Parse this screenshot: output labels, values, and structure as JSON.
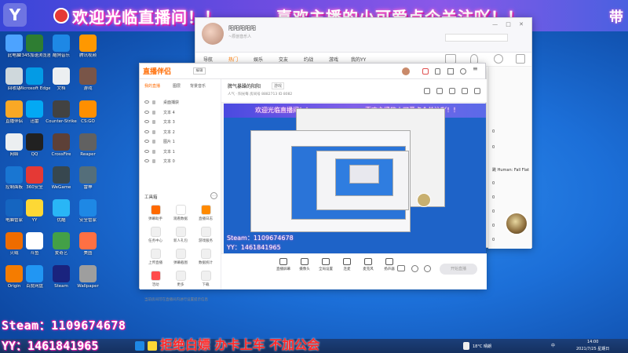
{
  "banner": {
    "logo_char": "Y",
    "welcome_text": "欢迎光临直播间！！",
    "follow_text": "喜欢主播的小可爱点个关注吖！！",
    "right_char": "带"
  },
  "desktop_icons": [
    {
      "label": "此电脑",
      "color": "#4da3ff"
    },
    {
      "label": "2345加速浏览器",
      "color": "#2e7d32"
    },
    {
      "label": "酷狗音乐",
      "color": "#1e88e5"
    },
    {
      "label": "腾讯视频",
      "color": "#ff9800"
    },
    {
      "label": "回收站",
      "color": "#cfd8dc"
    },
    {
      "label": "Microsoft Edge",
      "color": "#039be5"
    },
    {
      "label": "文档",
      "color": "#eceff1"
    },
    {
      "label": "游戏",
      "color": "#795548"
    },
    {
      "label": "直播伴侣",
      "color": "#f9a825"
    },
    {
      "label": "迅雷",
      "color": "#03a9f4"
    },
    {
      "label": "Counter-Strike",
      "color": "#424242"
    },
    {
      "label": "CS:GO",
      "color": "#ff8f00"
    },
    {
      "label": "网络",
      "color": "#eceff1"
    },
    {
      "label": "QQ",
      "color": "#212121"
    },
    {
      "label": "CrossFire",
      "color": "#5d4037"
    },
    {
      "label": "Reaper",
      "color": "#616161"
    },
    {
      "label": "控制面板",
      "color": "#1976d2"
    },
    {
      "label": "360安全",
      "color": "#e53935"
    },
    {
      "label": "WeGame",
      "color": "#37474f"
    },
    {
      "label": "雷神",
      "color": "#546e7a"
    },
    {
      "label": "电脑管家",
      "color": "#1565c0"
    },
    {
      "label": "YY",
      "color": "#fdd835"
    },
    {
      "label": "优酷",
      "color": "#29b6f6"
    },
    {
      "label": "安全管家",
      "color": "#1e88e5"
    },
    {
      "label": "火绒",
      "color": "#ef6c00"
    },
    {
      "label": "斗鱼",
      "color": "#ffffff"
    },
    {
      "label": "爱奇艺",
      "color": "#43a047"
    },
    {
      "label": "美图",
      "color": "#ff7043"
    },
    {
      "label": "Origin",
      "color": "#f57c00"
    },
    {
      "label": "百度网盘",
      "color": "#2196f3"
    },
    {
      "label": "Steam",
      "color": "#1a237e"
    },
    {
      "label": "Wallpaper",
      "color": "#9e9e9e"
    }
  ],
  "yy_window": {
    "user_name": "阳阳阳阳阳",
    "signature": "~原创音乐人",
    "search_placeholder": "",
    "nav": [
      "导航",
      "热门",
      "娱乐",
      "交友",
      "约战",
      "游戏",
      "我的YY"
    ],
    "active_nav_index": 1,
    "list_zeros": [
      "0",
      "0",
      "0",
      "0",
      "0",
      "0",
      "0",
      "0",
      "0",
      "0"
    ],
    "human_fall_flat": "跳 Human: Fall Flat"
  },
  "streamer_window": {
    "logo": "直播伴侣",
    "edit_label": "编辑",
    "tabs": [
      "我的直播",
      "图层",
      "背景音乐"
    ],
    "sources": [
      "桌面捕获",
      "文本 4",
      "文本 3",
      "文本 2",
      "图片 1",
      "文本 1",
      "文本 0"
    ],
    "tools_title": "工具箱",
    "tools": [
      {
        "label": "弹幕助手",
        "color": "#ff6a00"
      },
      {
        "label": "观看数据",
        "color": "#ffffff"
      },
      {
        "label": "直播日志",
        "color": "#ff8a00"
      },
      {
        "label": "任务中心",
        "color": "#f0f0f0"
      },
      {
        "label": "新人礼包",
        "color": "#f0f0f0"
      },
      {
        "label": "游戏服务",
        "color": "#f0f0f0"
      },
      {
        "label": "上传直播",
        "color": "#f0f0f0"
      },
      {
        "label": "弹幕截图",
        "color": "#f0f0f0"
      },
      {
        "label": "数据统计",
        "color": "#f0f0f0"
      },
      {
        "label": "活动",
        "color": "#ff4d4d"
      },
      {
        "label": "更多",
        "color": "#f0f0f0"
      },
      {
        "label": "下载",
        "color": "#f0f0f0"
      }
    ],
    "room_title": "脾气暴躁的阳阳",
    "room_tag": "游戏",
    "room_info": "人气 · 阳光每  房间号 8882713  ID 8082",
    "bottom_buttons": [
      "直播屏幕",
      "摄像头",
      "全局设置",
      "连麦",
      "麦克风",
      "扬声器"
    ],
    "start_label": "开始直播",
    "hint": "当前房间可在直播间内进行设置提示信息"
  },
  "overlays": {
    "steam": "Steam：1109674678",
    "yy": "YY：1461841965",
    "slogan": "拒绝白嫖 办卡上车 不加公会"
  },
  "taskbar": {
    "weather": "18°C 晴朗",
    "ime": "中",
    "time": "14:00",
    "date": "2021/7/25 星期日"
  }
}
